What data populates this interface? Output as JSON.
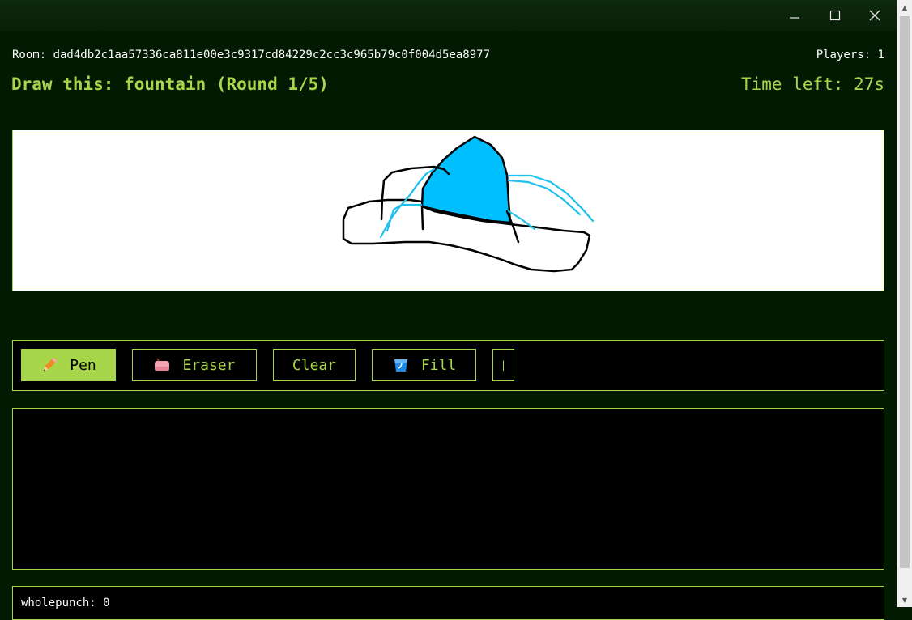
{
  "window": {
    "controls": [
      "minimize-icon",
      "maximize-icon",
      "close-icon"
    ]
  },
  "room": {
    "label": "Room: dad4db2c1aa57336ca811e00e3c9317cd84229c2cc3c965b79c0f004d5ea8977"
  },
  "players": {
    "label": "Players: 1"
  },
  "game": {
    "prompt": "Draw this: fountain (Round 1/5)",
    "timer": "Time left: 27s"
  },
  "toolbar": {
    "pen": "Pen",
    "eraser": "Eraser",
    "clear": "Clear",
    "fill": "Fill",
    "color_picker_value": "|",
    "active_tool": "pen"
  },
  "canvas": {
    "colors": {
      "stroke": "#000000",
      "accent": "#00bfff"
    }
  },
  "scores": [
    {
      "text": "wholepunch: 0"
    }
  ],
  "theme": {
    "background": "#021a02",
    "accent": "#a8d64a",
    "panel": "#000000"
  }
}
